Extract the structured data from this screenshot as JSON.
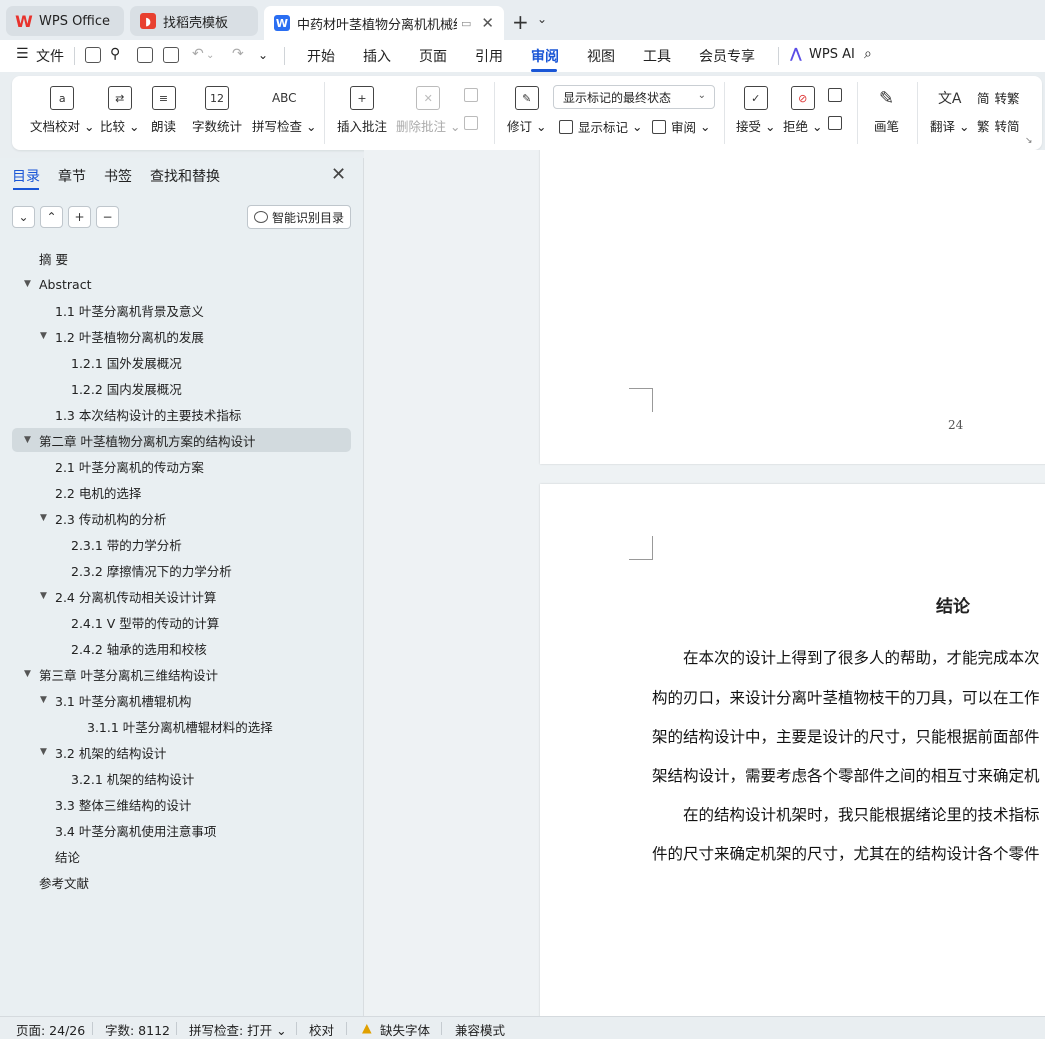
{
  "tabs": [
    {
      "label": "WPS Office"
    },
    {
      "label": "找稻壳模板"
    },
    {
      "label": "中药材叶茎植物分离机机械结构设计"
    }
  ],
  "menu": {
    "file": "文件",
    "items": [
      "开始",
      "插入",
      "页面",
      "引用",
      "审阅",
      "视图",
      "工具",
      "会员专享"
    ],
    "active": "审阅",
    "wps_ai": "WPS AI"
  },
  "ribbon": {
    "doc_check": "文档校对",
    "compare": "比较",
    "read_aloud": "朗读",
    "word_count": "字数统计",
    "spell_check": "拼写检查",
    "abc": "ABC",
    "count_glyph": "12",
    "insert_comment": "插入批注",
    "delete_comment": "删除批注",
    "track": "修订",
    "markup_state": "显示标记的最终状态",
    "show_markup": "显示标记",
    "review": "审阅",
    "accept": "接受",
    "reject": "拒绝",
    "ink": "画笔",
    "translate": "翻译",
    "to_traditional": "转繁",
    "to_simplified": "转简"
  },
  "panel": {
    "tabs": [
      "目录",
      "章节",
      "书签",
      "查找和替换"
    ],
    "active_tab": "目录",
    "smart_toc": "智能识别目录"
  },
  "toc": [
    {
      "text": "摘  要",
      "level": 0,
      "arrow": ""
    },
    {
      "text": "Abstract",
      "level": 0,
      "arrow": "▼"
    },
    {
      "text": "1.1 叶茎分离机背景及意义",
      "level": 1,
      "arrow": ""
    },
    {
      "text": "1.2  叶茎植物分离机的发展",
      "level": 1,
      "arrow": "▼"
    },
    {
      "text": "1.2.1 国外发展概况",
      "level": 2,
      "arrow": ""
    },
    {
      "text": "1.2.2 国内发展概况",
      "level": 2,
      "arrow": ""
    },
    {
      "text": "1.3  本次结构设计的主要技术指标",
      "level": 1,
      "arrow": ""
    },
    {
      "text": "第二章  叶茎植物分离机方案的结构设计",
      "level": 0,
      "arrow": "▼",
      "selected": true
    },
    {
      "text": "2.1  叶茎分离机的传动方案",
      "level": 1,
      "arrow": ""
    },
    {
      "text": "2.2 电机的选择",
      "level": 1,
      "arrow": ""
    },
    {
      "text": "2.3 传动机构的分析",
      "level": 1,
      "arrow": "▼"
    },
    {
      "text": "2.3.1 带的力学分析",
      "level": 2,
      "arrow": ""
    },
    {
      "text": "2.3.2 摩擦情况下的力学分析",
      "level": 2,
      "arrow": ""
    },
    {
      "text": "2.4  分离机传动相关设计计算",
      "level": 1,
      "arrow": "▼"
    },
    {
      "text": "2.4.1 V 型带的传动的计算",
      "level": 2,
      "arrow": ""
    },
    {
      "text": "2.4.2  轴承的选用和校核",
      "level": 2,
      "arrow": ""
    },
    {
      "text": "第三章    叶茎分离机三维结构设计",
      "level": 0,
      "arrow": "▼"
    },
    {
      "text": "3.1 叶茎分离机槽辊机构",
      "level": 1,
      "arrow": "▼"
    },
    {
      "text": "3.1.1 叶茎分离机槽辊材料的选择",
      "level": 3,
      "arrow": ""
    },
    {
      "text": "3.2  机架的结构设计",
      "level": 1,
      "arrow": "▼"
    },
    {
      "text": "3.2.1 机架的结构设计",
      "level": 2,
      "arrow": ""
    },
    {
      "text": "3.3 整体三维结构的设计",
      "level": 1,
      "arrow": ""
    },
    {
      "text": "3.4 叶茎分离机使用注意事项",
      "level": 1,
      "arrow": ""
    },
    {
      "text": "结论",
      "level": 1,
      "arrow": ""
    },
    {
      "text": "参考文献",
      "level": 0,
      "arrow": ""
    }
  ],
  "document": {
    "page_number": "24",
    "title": "结论",
    "lines": [
      "　　在本次的设计上得到了很多人的帮助，才能完成本次",
      "构的刃口，来设计分离叶茎植物枝干的刀具，可以在工作",
      "架的结构设计中，主要是设计的尺寸，只能根据前面部件",
      "架结构设计，需要考虑各个零部件之间的相互寸来确定机",
      "　　在的结构设计机架时，我只能根据绪论里的技术指标",
      "件的尺寸来确定机架的尺寸，尤其在的结构设计各个零件"
    ]
  },
  "status": {
    "page": "页面: 24/26",
    "words": "字数: 8112",
    "spell": "拼写检查: 打开",
    "proof": "校对",
    "missing_font": "缺失字体",
    "compat": "兼容模式"
  }
}
